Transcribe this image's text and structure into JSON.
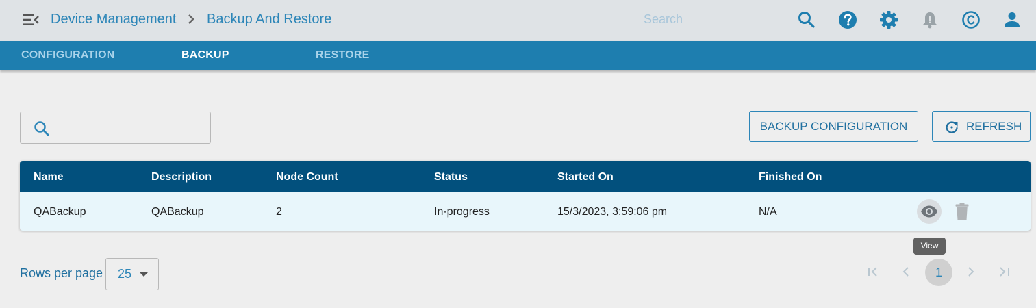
{
  "header": {
    "breadcrumb": [
      "Device Management",
      "Backup And Restore"
    ],
    "search_placeholder": "Search",
    "icons": [
      "menu-collapse-icon",
      "search-icon",
      "help-icon",
      "gear-icon",
      "bell-icon",
      "copyright-icon",
      "user-icon"
    ]
  },
  "tabs": [
    {
      "label": "CONFIGURATION",
      "active": false
    },
    {
      "label": "BACKUP",
      "active": true
    },
    {
      "label": "RESTORE",
      "active": false
    }
  ],
  "toolbar": {
    "filter_placeholder": "",
    "backup_label": "BACKUP CONFIGURATION",
    "refresh_label": "REFRESH"
  },
  "table": {
    "columns": [
      "Name",
      "Description",
      "Node Count",
      "Status",
      "Started On",
      "Finished On"
    ],
    "rows": [
      {
        "name": "QABackup",
        "description": "QABackup",
        "node_count": "2",
        "status": "In-progress",
        "started_on": "15/3/2023, 3:59:06 pm",
        "finished_on": "N/A"
      }
    ],
    "row_actions": [
      "view-icon",
      "delete-icon"
    ],
    "tooltip": "View"
  },
  "pagination": {
    "rows_per_page_label": "Rows per page",
    "rows_per_page_value": "25",
    "current_page": "1"
  },
  "colors": {
    "accent": "#2d86b8",
    "tab_bar": "#1e7eaf",
    "table_header": "#02507d",
    "row_background": "#e8f6fb"
  }
}
